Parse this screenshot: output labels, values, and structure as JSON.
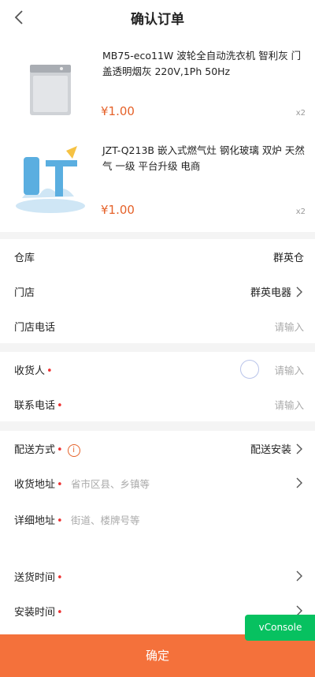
{
  "header": {
    "title": "确认订单"
  },
  "products": [
    {
      "name": "MB75-eco11W 波轮全自动洗衣机 智利灰 门盖透明烟灰            220V,1Ph 50Hz",
      "price": "¥1.00",
      "qty": "x2"
    },
    {
      "name": "JZT-Q213B 嵌入式燃气灶 钢化玻璃 双炉 天然气 一级 平台升级 电商",
      "price": "¥1.00",
      "qty": "x2"
    }
  ],
  "store_section": {
    "warehouse_label": "仓库",
    "warehouse_value": "群英仓",
    "store_label": "门店",
    "store_value": "群英电器",
    "store_phone_label": "门店电话",
    "store_phone_placeholder": "请输入"
  },
  "receiver_section": {
    "receiver_label": "收货人",
    "receiver_placeholder": "请输入",
    "phone_label": "联系电话",
    "phone_placeholder": "请输入"
  },
  "delivery_section": {
    "method_label": "配送方式",
    "method_value": "配送安装",
    "address_label": "收货地址",
    "address_placeholder": "省市区县、乡镇等",
    "detail_label": "详细地址",
    "detail_placeholder": "街道、楼牌号等",
    "delivery_time_label": "送货时间",
    "install_time_label": "安装时间"
  },
  "required_mark": "•",
  "info_icon_glyph": "i",
  "confirm_button": "确定",
  "vconsole_label": "vConsole",
  "colors": {
    "accent": "#f4713b",
    "price": "#e5622a",
    "vconsole": "#07c160"
  }
}
